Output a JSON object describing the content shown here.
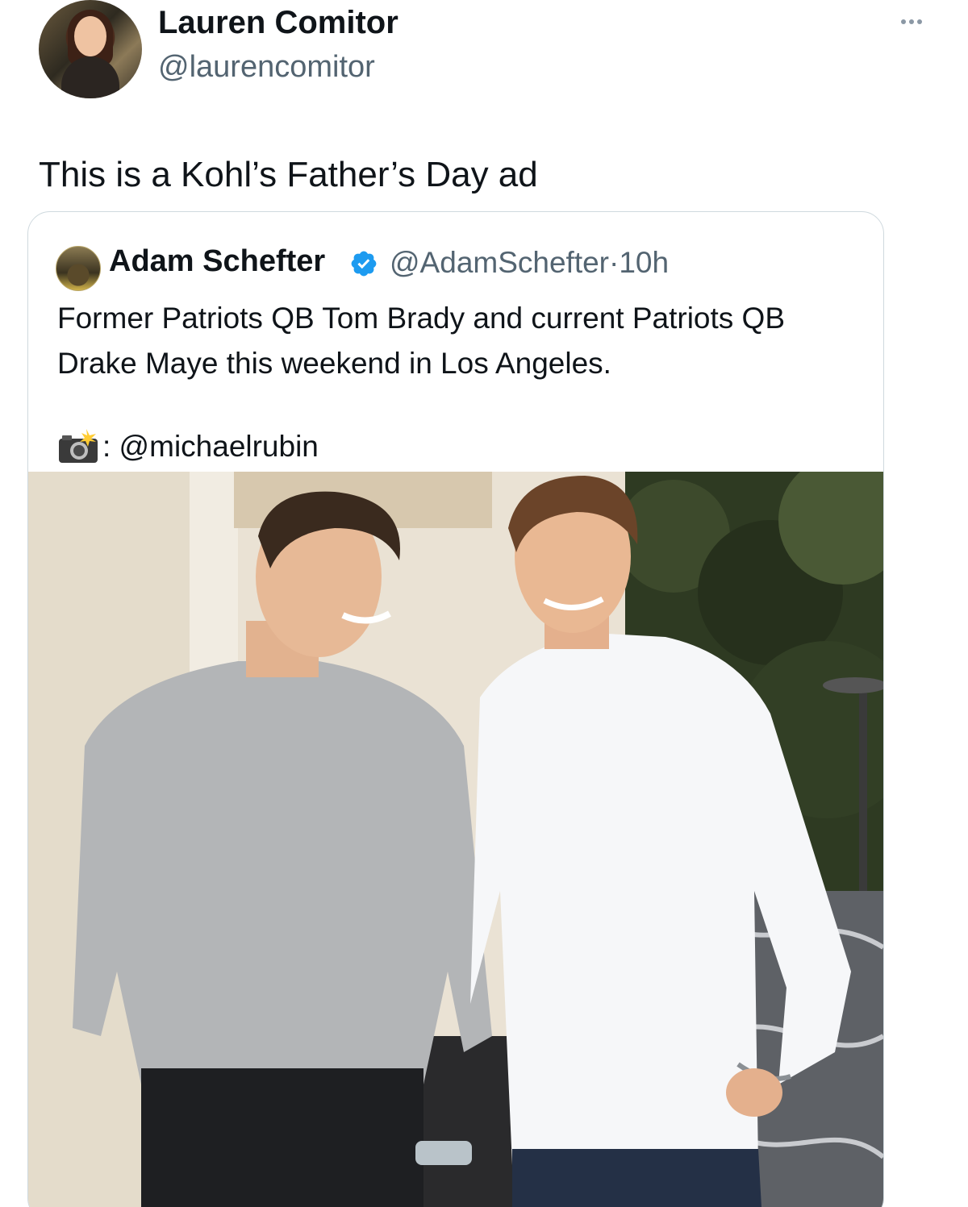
{
  "tweet": {
    "author_name": "Lauren Comitor",
    "author_handle": "@laurencomitor",
    "text": "This is a Kohl’s Father’s Day ad",
    "more_icon": "more-horizontal-icon"
  },
  "quoted_tweet": {
    "author_name": "Adam Schefter",
    "verified_icon": "verified-badge-icon",
    "verified_color": "#1d9bf0",
    "author_handle": "@AdamSchefter",
    "separator": "·",
    "time": "10h",
    "text": "Former Patriots QB Tom Brady and current Patriots QB Drake Maye this weekend in Los Angeles.",
    "credit_icon": "camera-flash-icon",
    "credit_text": ": @michaelrubin"
  },
  "colors": {
    "text_primary": "#0f1419",
    "text_secondary": "#536471",
    "border": "#cfd9de"
  }
}
